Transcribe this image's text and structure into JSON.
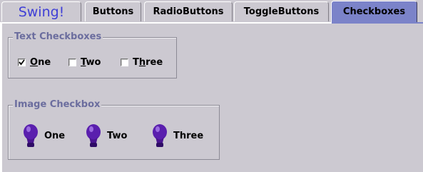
{
  "tabs": [
    {
      "label": "Swing!",
      "selected": false,
      "logo": true
    },
    {
      "label": "Buttons",
      "selected": false
    },
    {
      "label": "RadioButtons",
      "selected": false
    },
    {
      "label": "ToggleButtons",
      "selected": false
    },
    {
      "label": "Checkboxes",
      "selected": true
    }
  ],
  "text_group": {
    "title": "Text Checkboxes",
    "items": [
      {
        "first": "O",
        "rest": "ne",
        "checked": true
      },
      {
        "first": "T",
        "rest": "wo",
        "checked": false
      },
      {
        "first": "Th",
        "rest": "ree",
        "checked": false,
        "underline_index": 1
      }
    ]
  },
  "image_group": {
    "title": "Image Checkbox",
    "items": [
      {
        "label": "One",
        "icon": "lightbulb-icon"
      },
      {
        "label": "Two",
        "icon": "lightbulb-icon"
      },
      {
        "label": "Three",
        "icon": "lightbulb-icon"
      }
    ]
  },
  "colors": {
    "background": "#ccc9d1",
    "selected_tab": "#7b83c9",
    "group_title": "#6b6d9e",
    "bulb": "#5a1fae"
  }
}
